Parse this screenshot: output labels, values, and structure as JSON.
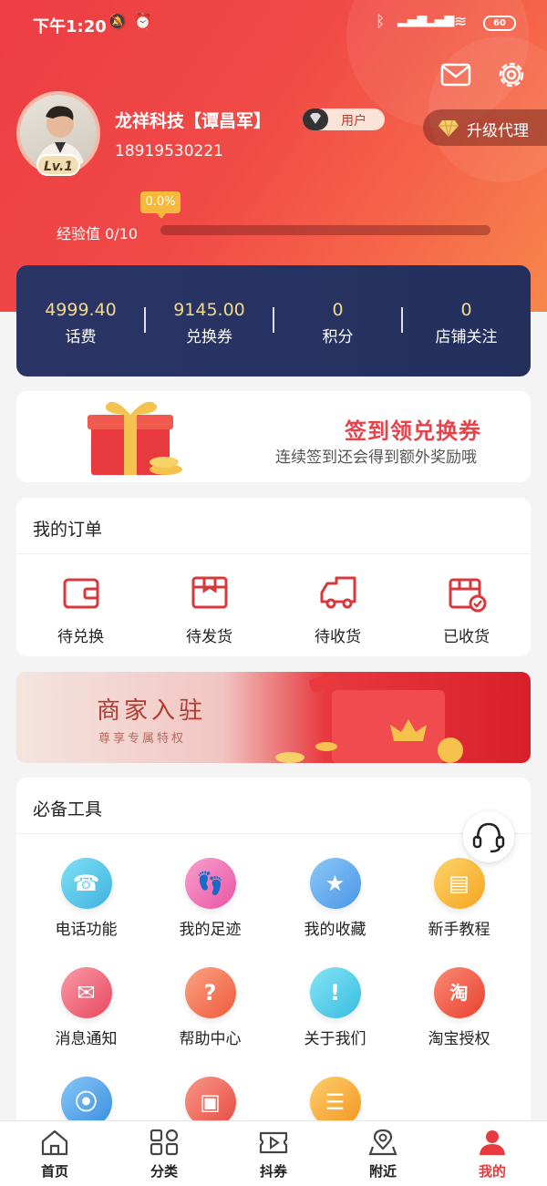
{
  "status_bar": {
    "time": "下午1:20",
    "battery": "60"
  },
  "profile": {
    "level": "Lv.1",
    "name": "龙祥科技【谭昌军】",
    "role": "用户",
    "phone": "18919530221",
    "upgrade_label": "升级代理",
    "exp_label": "经验值 0/10",
    "exp_percent_label": "0.0%",
    "exp_progress": 0
  },
  "stats": [
    {
      "value": "4999.40",
      "label": "话费"
    },
    {
      "value": "9145.00",
      "label": "兑换券"
    },
    {
      "value": "0",
      "label": "积分"
    },
    {
      "value": "0",
      "label": "店铺关注"
    }
  ],
  "signin": {
    "title": "签到领兑换券",
    "subtitle": "连续签到还会得到额外奖励哦"
  },
  "orders": {
    "title": "我的订单",
    "items": [
      {
        "label": "待兑换",
        "icon": "wallet-icon"
      },
      {
        "label": "待发货",
        "icon": "box-icon"
      },
      {
        "label": "待收货",
        "icon": "truck-icon"
      },
      {
        "label": "已收货",
        "icon": "received-icon"
      }
    ]
  },
  "merchant": {
    "title": "商家入驻",
    "subtitle": "尊享专属特权"
  },
  "tools": {
    "title": "必备工具",
    "items": [
      {
        "label": "电话功能",
        "icon": "phone-icon",
        "color": "#4fc3e8"
      },
      {
        "label": "我的足迹",
        "icon": "footprint-icon",
        "color": "#f06fb0"
      },
      {
        "label": "我的收藏",
        "icon": "star-icon",
        "color": "#5aa8ef"
      },
      {
        "label": "新手教程",
        "icon": "book-icon",
        "color": "#f7b733"
      },
      {
        "label": "消息通知",
        "icon": "mail-icon",
        "color": "#f06a7a"
      },
      {
        "label": "帮助中心",
        "icon": "help-icon",
        "color": "#f5795a"
      },
      {
        "label": "关于我们",
        "icon": "info-icon",
        "color": "#4ccbe8"
      },
      {
        "label": "淘宝授权",
        "icon": "taobao-icon",
        "color": "#f25a48"
      },
      {
        "label": "",
        "icon": "location-icon",
        "color": "#4fa7ea"
      },
      {
        "label": "",
        "icon": "image-icon",
        "color": "#f0645a"
      },
      {
        "label": "",
        "icon": "store-icon",
        "color": "#f6a833"
      }
    ]
  },
  "tabbar": [
    {
      "label": "首页",
      "icon": "home-icon"
    },
    {
      "label": "分类",
      "icon": "category-icon"
    },
    {
      "label": "抖券",
      "icon": "video-coupon-icon"
    },
    {
      "label": "附近",
      "icon": "location-pin-icon"
    },
    {
      "label": "我的",
      "icon": "person-icon",
      "active": true
    }
  ],
  "colors": {
    "brand_red": "#e8393f",
    "navy": "#2a3566",
    "gold": "#f3d98b"
  }
}
